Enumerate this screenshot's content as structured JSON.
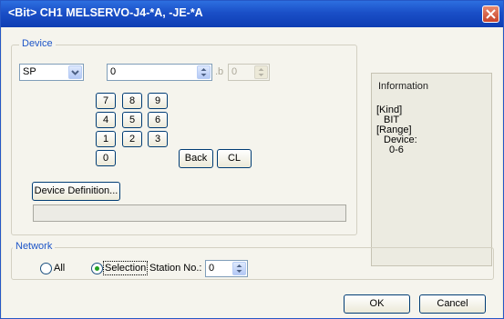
{
  "window": {
    "title": "<Bit> CH1 MELSERVO-J4-*A, -JE-*A"
  },
  "device": {
    "group_title": "Device",
    "type_value": "SP",
    "number_value": "0",
    "bit_prefix": ".b",
    "bit_value": "0",
    "keypad": [
      "7",
      "8",
      "9",
      "4",
      "5",
      "6",
      "1",
      "2",
      "3",
      "0"
    ],
    "back_label": "Back",
    "clear_label": "CL",
    "definition_button": "Device Definition..."
  },
  "information": {
    "title": "Information",
    "kind_label": "[Kind]",
    "kind_value": "BIT",
    "range_label": "[Range]",
    "device_label": "Device:",
    "range_value": "0-6"
  },
  "network": {
    "group_title": "Network",
    "all_label": "All",
    "selection_label": "Selection",
    "selected": "Selection",
    "station_label": "Station No.:",
    "station_value": "0"
  },
  "buttons": {
    "ok": "OK",
    "cancel": "Cancel"
  }
}
